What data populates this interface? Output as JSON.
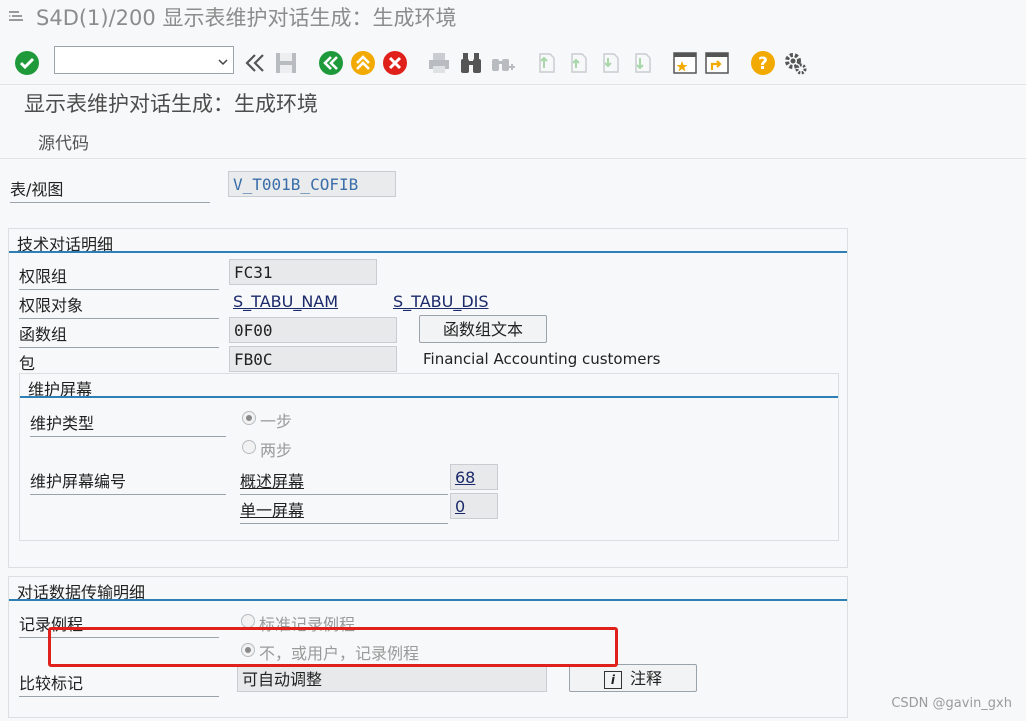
{
  "window": {
    "title": "S4D(1)/200 显示表维护对话生成：生成环境"
  },
  "toolbar": {
    "command_value": "",
    "icons": [
      "check-icon",
      "back-nav-icon",
      "save-icon",
      "back-icon",
      "exit-icon",
      "cancel-icon",
      "print-icon",
      "find-icon",
      "find-next-icon",
      "first-page-icon",
      "prev-page-icon",
      "next-page-icon",
      "last-page-icon",
      "new-session-icon",
      "shortcut-icon",
      "help-icon",
      "settings-icon"
    ],
    "colors": {
      "ok": "#1f9a3a",
      "exit": "#f2a900",
      "cancel": "#e0201b",
      "help": "#f2a900"
    }
  },
  "heading": "显示表维护对话生成：生成环境",
  "app_toolbar": {
    "source_code": "源代码"
  },
  "table_view": {
    "label": "表/视图",
    "value": "V_T001B_COFIB"
  },
  "tech_details": {
    "title": "技术对话明细",
    "auth_group_label": "权限组",
    "auth_group_value": "FC31",
    "auth_object_label": "权限对象",
    "auth_object_link1": "S_TABU_NAM",
    "auth_object_link2": "S_TABU_DIS",
    "function_group_label": "函数组",
    "function_group_value": "0F00",
    "function_group_text_button": "函数组文本",
    "package_label": "包",
    "package_value": "FB0C",
    "package_desc": "Financial Accounting customers"
  },
  "maint_screens": {
    "title": "维护屏幕",
    "type_label": "维护类型",
    "type_one_step": "一步",
    "type_two_step": "两步",
    "type_selected": "one_step",
    "numbers_label": "维护屏幕编号",
    "overview_label": "概述屏幕",
    "overview_value": "68",
    "single_label": "单一屏幕",
    "single_value": "0"
  },
  "transport": {
    "title": "对话数据传输明细",
    "routine_label": "记录例程",
    "routine_standard": "标准记录例程",
    "routine_none": "不，或用户，记录例程",
    "routine_selected": "none",
    "compare_label": "比较标记",
    "compare_value": "可自动调整",
    "note_button": "注释"
  },
  "highlight_color": "#e0201b",
  "watermark": "CSDN @gavin_gxh"
}
